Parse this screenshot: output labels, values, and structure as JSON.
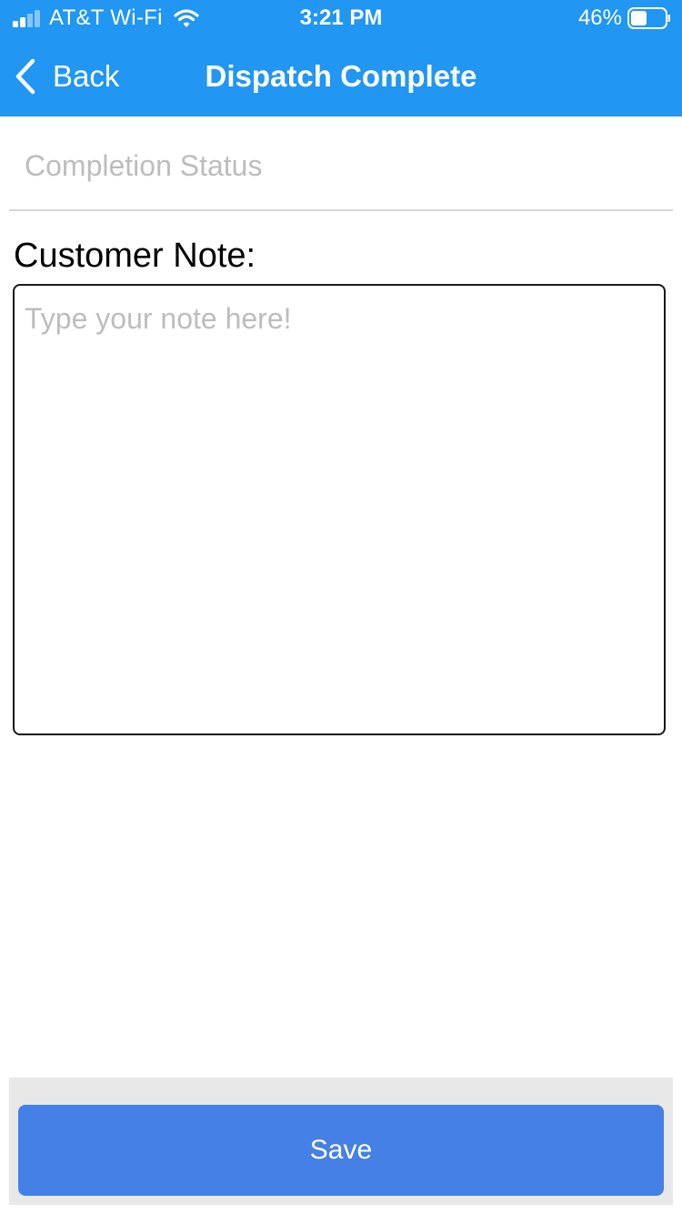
{
  "status_bar": {
    "carrier": "AT&T Wi-Fi",
    "time": "3:21 PM",
    "battery_percent": "46%",
    "battery_level": 0.46,
    "signal_bars_active": 2,
    "signal_bars_total": 4,
    "icons": {
      "signal": "cellular-signal-icon",
      "wifi": "wifi-icon",
      "battery": "battery-icon"
    }
  },
  "nav": {
    "back_label": "Back",
    "back_icon": "chevron-left-icon",
    "title": "Dispatch Complete"
  },
  "form": {
    "completion_status": {
      "placeholder": "Completion Status",
      "value": ""
    },
    "customer_note": {
      "label": "Customer Note:",
      "placeholder": "Type your note here!",
      "value": ""
    }
  },
  "footer": {
    "save_label": "Save"
  },
  "colors": {
    "header_blue": "#2196f3",
    "button_blue": "#4580e6",
    "placeholder_gray": "#bdbdbd",
    "footer_gray": "#e8e8e8"
  }
}
